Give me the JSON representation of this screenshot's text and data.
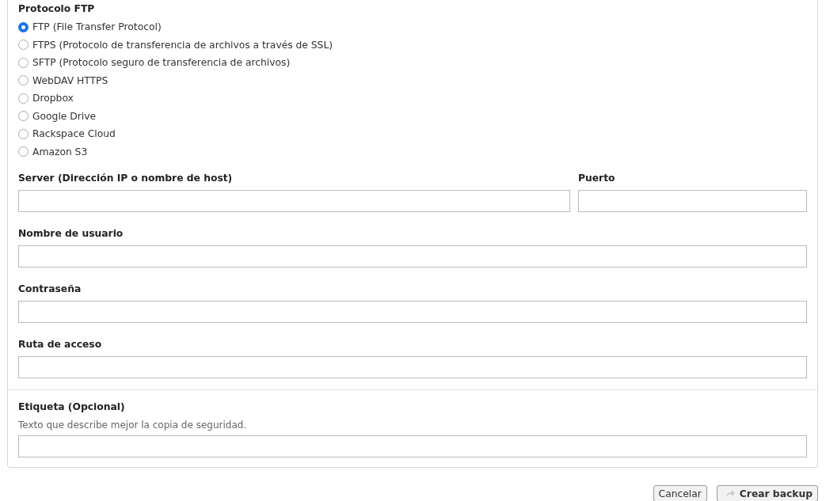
{
  "protocol": {
    "label": "Protocolo FTP",
    "options": [
      {
        "label": "FTP (File Transfer Protocol)",
        "selected": true
      },
      {
        "label": "FTPS (Protocolo de transferencia de archivos a través de SSL)",
        "selected": false
      },
      {
        "label": "SFTP (Protocolo seguro de transferencia de archivos)",
        "selected": false
      },
      {
        "label": "WebDAV HTTPS",
        "selected": false
      },
      {
        "label": "Dropbox",
        "selected": false
      },
      {
        "label": "Google Drive",
        "selected": false
      },
      {
        "label": "Rackspace Cloud",
        "selected": false
      },
      {
        "label": "Amazon S3",
        "selected": false
      }
    ]
  },
  "server": {
    "label": "Server (Dirección IP o nombre de host)"
  },
  "port": {
    "label": "Puerto"
  },
  "fields": [
    {
      "label": "Nombre de usuario"
    },
    {
      "label": "Contraseña"
    },
    {
      "label": "Ruta de acceso"
    }
  ],
  "tag": {
    "label": "Etiqueta (Opcional)",
    "help": "Texto que describe mejor la copia de seguridad."
  },
  "buttons": {
    "cancel": "Cancelar",
    "create": "Crear backup"
  }
}
